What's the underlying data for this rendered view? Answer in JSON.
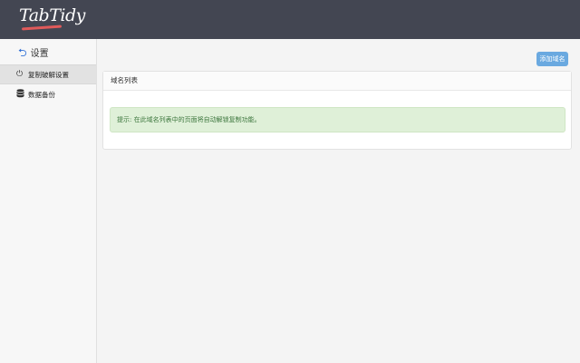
{
  "topbar": {
    "logo_text": "TabTidy"
  },
  "sidebar": {
    "back_label": "设置",
    "items": [
      {
        "label": "复制破解设置",
        "icon": "power-icon",
        "active": true
      },
      {
        "label": "数据备份",
        "icon": "database-icon",
        "active": false
      }
    ]
  },
  "main": {
    "add_button_label": "添加域名",
    "panel_title": "域名列表",
    "hint_text": "提示: 在此域名列表中的页面将自动解锁复制功能。"
  },
  "colors": {
    "topbar": "#434652",
    "accent": "#6aa9e0",
    "hint_bg": "#dff0d8",
    "hint_text": "#3c763d"
  }
}
